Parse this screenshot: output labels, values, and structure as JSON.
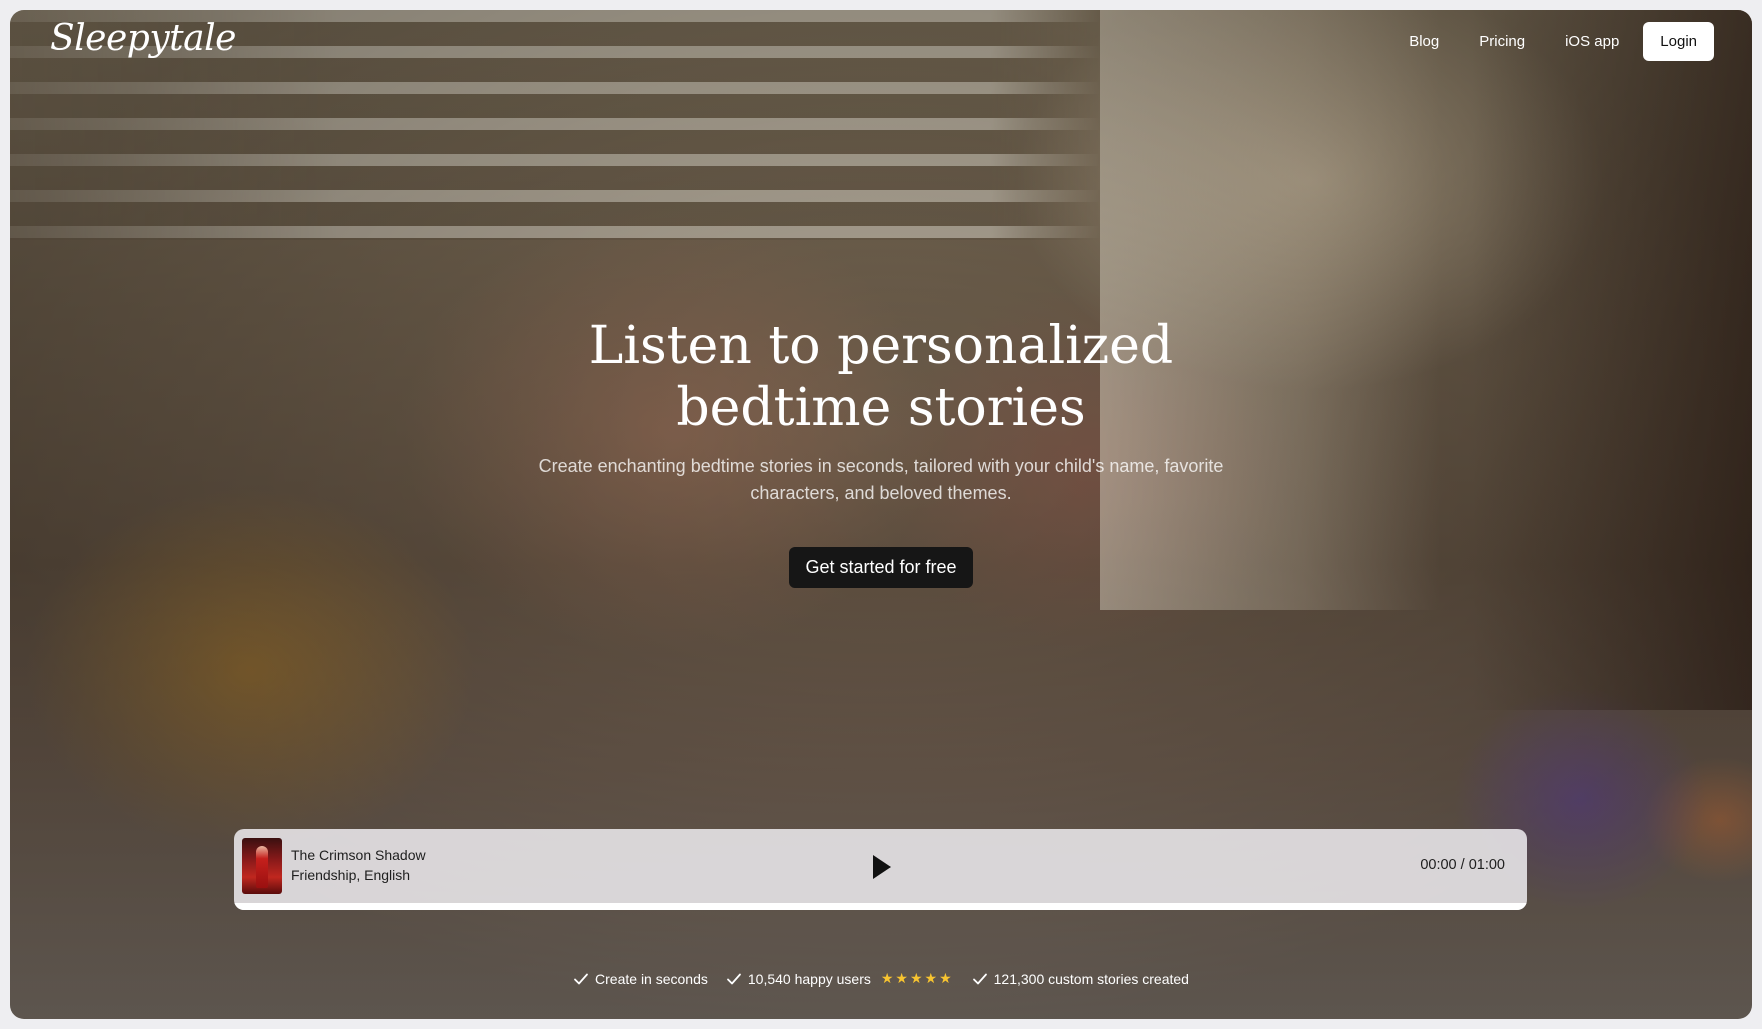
{
  "brand": {
    "logo_text": "Sleepytale"
  },
  "nav": {
    "items": [
      {
        "label": "Blog"
      },
      {
        "label": "Pricing"
      },
      {
        "label": "iOS app"
      }
    ],
    "login_label": "Login"
  },
  "hero": {
    "headline": "Listen to personalized bedtime stories",
    "subheadline": "Create enchanting bedtime stories in seconds, tailored with your child's name, favorite characters, and beloved themes.",
    "cta_label": "Get started for free"
  },
  "player": {
    "title": "The Crimson Shadow",
    "meta": "Friendship, English",
    "time": "00:00 / 01:00",
    "progress": 0,
    "cover_icon": "story-cover-image",
    "play_icon": "play-icon"
  },
  "stats": {
    "create": "Create in seconds",
    "users": "10,540 happy users",
    "rating_stars": "★★★★★",
    "stories": "121,300 custom stories created",
    "check_icon": "check-icon",
    "star_color": "#f7c430"
  }
}
